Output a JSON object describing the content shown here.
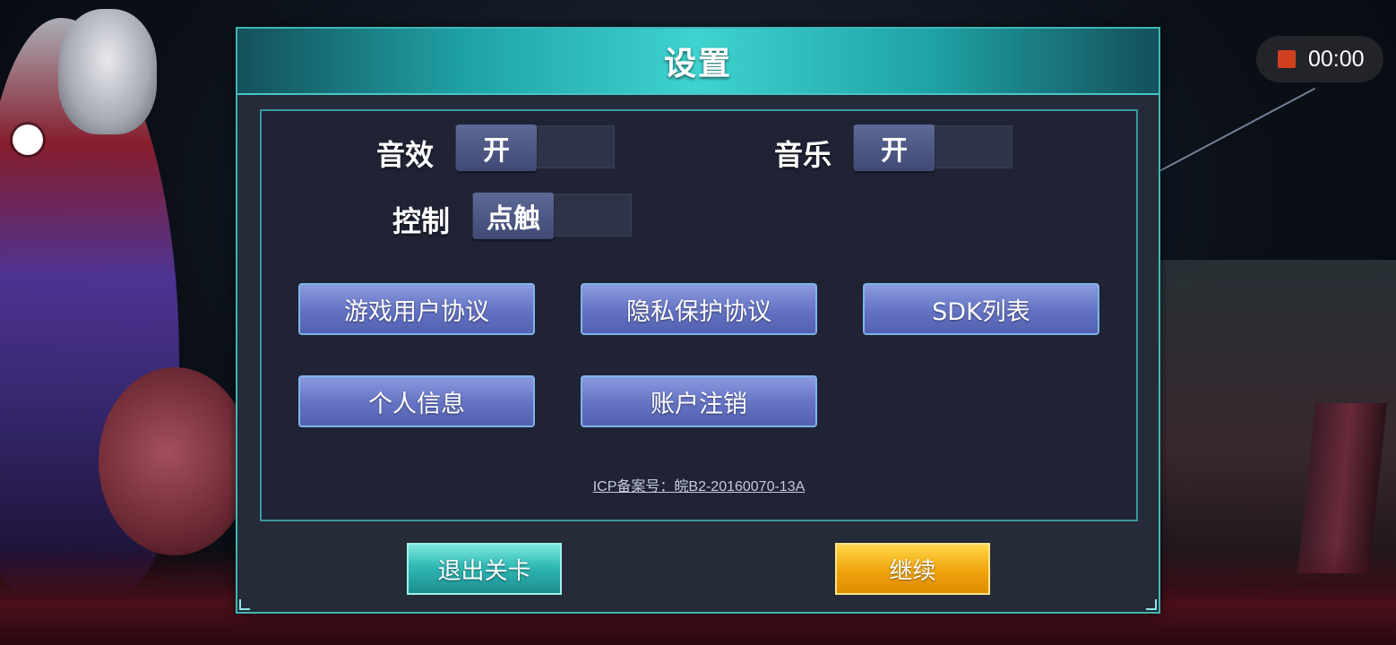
{
  "dialog": {
    "title": "设置"
  },
  "settings": {
    "sound_effects": {
      "label": "音效",
      "value": "开"
    },
    "music": {
      "label": "音乐",
      "value": "开"
    },
    "control": {
      "label": "控制",
      "value": "点触"
    }
  },
  "menu_buttons": [
    {
      "label": "游戏用户协议"
    },
    {
      "label": "隐私保护协议"
    },
    {
      "label": "SDK列表"
    },
    {
      "label": "个人信息"
    },
    {
      "label": "账户注销"
    }
  ],
  "icp": "ICP备案号：皖B2-20160070-13A",
  "bottom_buttons": {
    "exit": "退出关卡",
    "continue": "继续"
  },
  "recorder": {
    "time": "00:00"
  },
  "colors": {
    "accent": "#3fb6b4",
    "menu_button": "#6372c2",
    "continue_button": "#f2a70f",
    "exit_button": "#2fb8b4"
  }
}
